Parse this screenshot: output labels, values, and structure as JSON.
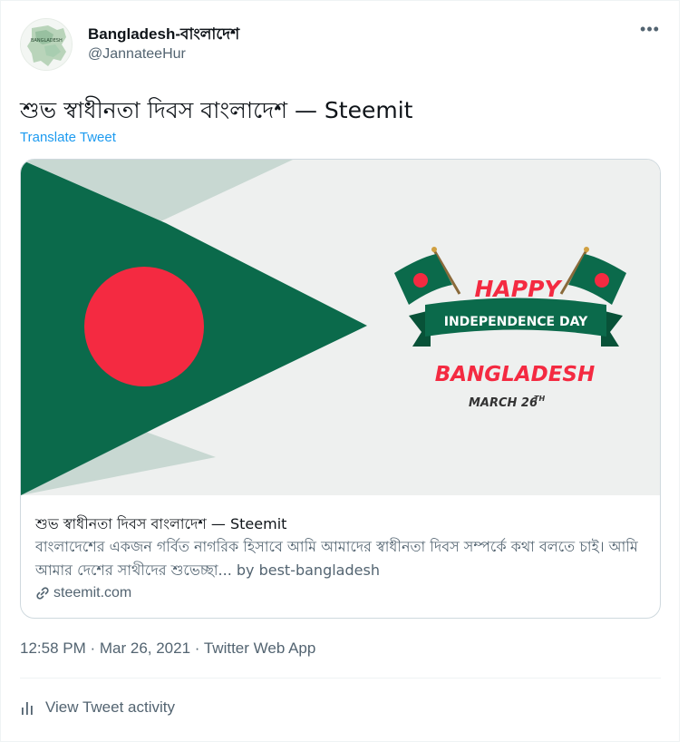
{
  "author": {
    "name": "Bangladesh-বাংলাদেশ",
    "handle": "@JannateeHur",
    "avatar_icon": "bangladesh-map-avatar",
    "avatar_text": "BANGLADESH"
  },
  "menu": {
    "more_label": "•••"
  },
  "tweet": {
    "text": "শুভ স্বাধীনতা দিবস বাংলাদেশ — Steemit",
    "translate_label": "Translate Tweet"
  },
  "card": {
    "image": {
      "happy": "HAPPY",
      "ribbon": "INDEPENDENCE DAY",
      "country": "BANGLADESH",
      "date_prefix": "MARCH 26",
      "date_suffix": "TH",
      "colors": {
        "green": "#0b6a4b",
        "red": "#f42a41",
        "pale": "#c8d8d2",
        "background": "#eef0ef"
      }
    },
    "title": "শুভ স্বাধীনতা দিবস বাংলাদেশ — Steemit",
    "description": "বাংলাদেশের একজন গর্বিত নাগরিক হিসাবে আমি আমাদের স্বাধীনতা দিবস সম্পর্কে কথা বলতে চাই। আমি আমার দেশের সাথীদের শুভেচ্ছা... by best-bangladesh",
    "link_icon": "link-icon",
    "domain": "steemit.com"
  },
  "meta": {
    "text": "12:58 PM · Mar 26, 2021 · Twitter Web App"
  },
  "activity": {
    "icon": "bar-chart-icon",
    "label": "View Tweet activity"
  },
  "colors": {
    "link_blue": "#1d9bf0",
    "secondary_text": "#536471",
    "border": "#cfd9de"
  }
}
